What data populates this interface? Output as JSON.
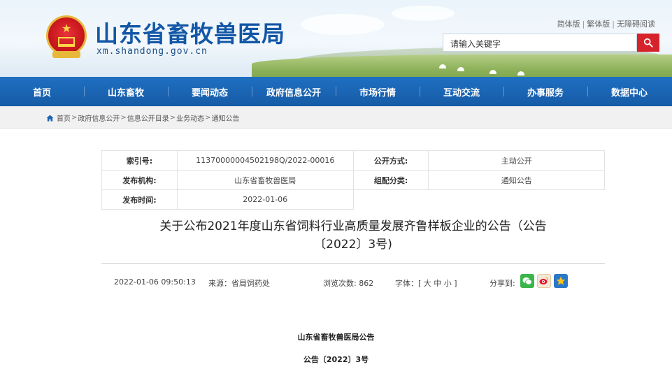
{
  "header": {
    "site_title": "山东省畜牧兽医局",
    "domain": "xm.shandong.gov.cn",
    "lang_links": [
      "简体版",
      "繁体版",
      "无障碍阅读"
    ],
    "search_placeholder": "请输入关键字"
  },
  "nav": {
    "items": [
      "首页",
      "山东畜牧",
      "要闻动态",
      "政府信息公开",
      "市场行情",
      "互动交流",
      "办事服务",
      "数据中心"
    ]
  },
  "breadcrumb": {
    "items": [
      "首页",
      "政府信息公开",
      "信息公开目录",
      "业务动态",
      "通知公告"
    ],
    "separator": ">"
  },
  "meta": {
    "index_label": "索引号:",
    "index_value": "11370000004502198Q/2022-00016",
    "method_label": "公开方式:",
    "method_value": "主动公开",
    "publisher_label": "发布机构:",
    "publisher_value": "山东省畜牧兽医局",
    "category_label": "组配分类:",
    "category_value": "通知公告",
    "date_label": "发布时间:",
    "date_value": "2022-01-06"
  },
  "article": {
    "title_line1": "关于公布2021年度山东省饲料行业高质量发展齐鲁样板企业的公告（公告",
    "title_line2": "〔2022〕3号)",
    "datetime": "2022-01-06 09:50:13",
    "source": "来源：省局饲药处",
    "views_label": "浏览次数:",
    "views": "862",
    "font_label": "字体：[",
    "font_large": "大",
    "font_medium": "中",
    "font_small": "小",
    "font_close": "]",
    "share_label": "分享到:",
    "body_heading": "山东省畜牧兽医局公告",
    "body_number": "公告〔2022〕3号"
  },
  "colors": {
    "nav_blue": "#1b64b4",
    "title_blue": "#1357a6",
    "search_red": "#d6222b"
  }
}
